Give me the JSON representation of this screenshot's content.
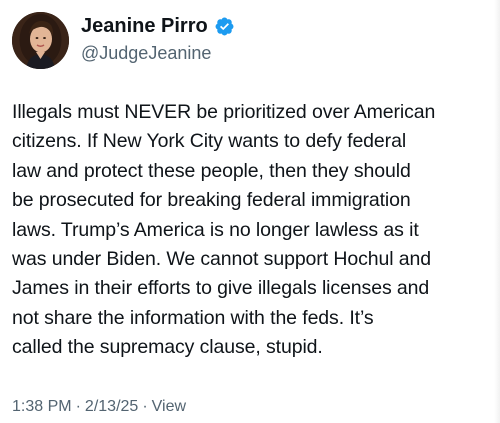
{
  "author": {
    "display_name": "Jeanine Pirro",
    "handle": "@JudgeJeanine",
    "verified_color": "#1d9bf0"
  },
  "tweet": {
    "text": "Illegals must NEVER be prioritized over American\ncitizens. If New York City wants to defy federal\nlaw and protect these people, then they should\nbe prosecuted for breaking federal immigration\nlaws. Trump’s America is no longer lawless as it\nwas under Biden. We cannot support Hochul and\nJames in their efforts to give illegals licenses and\nnot share the information with the feds. It’s\ncalled the supremacy clause, stupid."
  },
  "meta": {
    "time": "1:38 PM",
    "date": "2/13/25",
    "views_label": "View",
    "separator": "·"
  },
  "icons": {
    "verified": "verified-badge-icon",
    "avatar": "profile-photo"
  }
}
